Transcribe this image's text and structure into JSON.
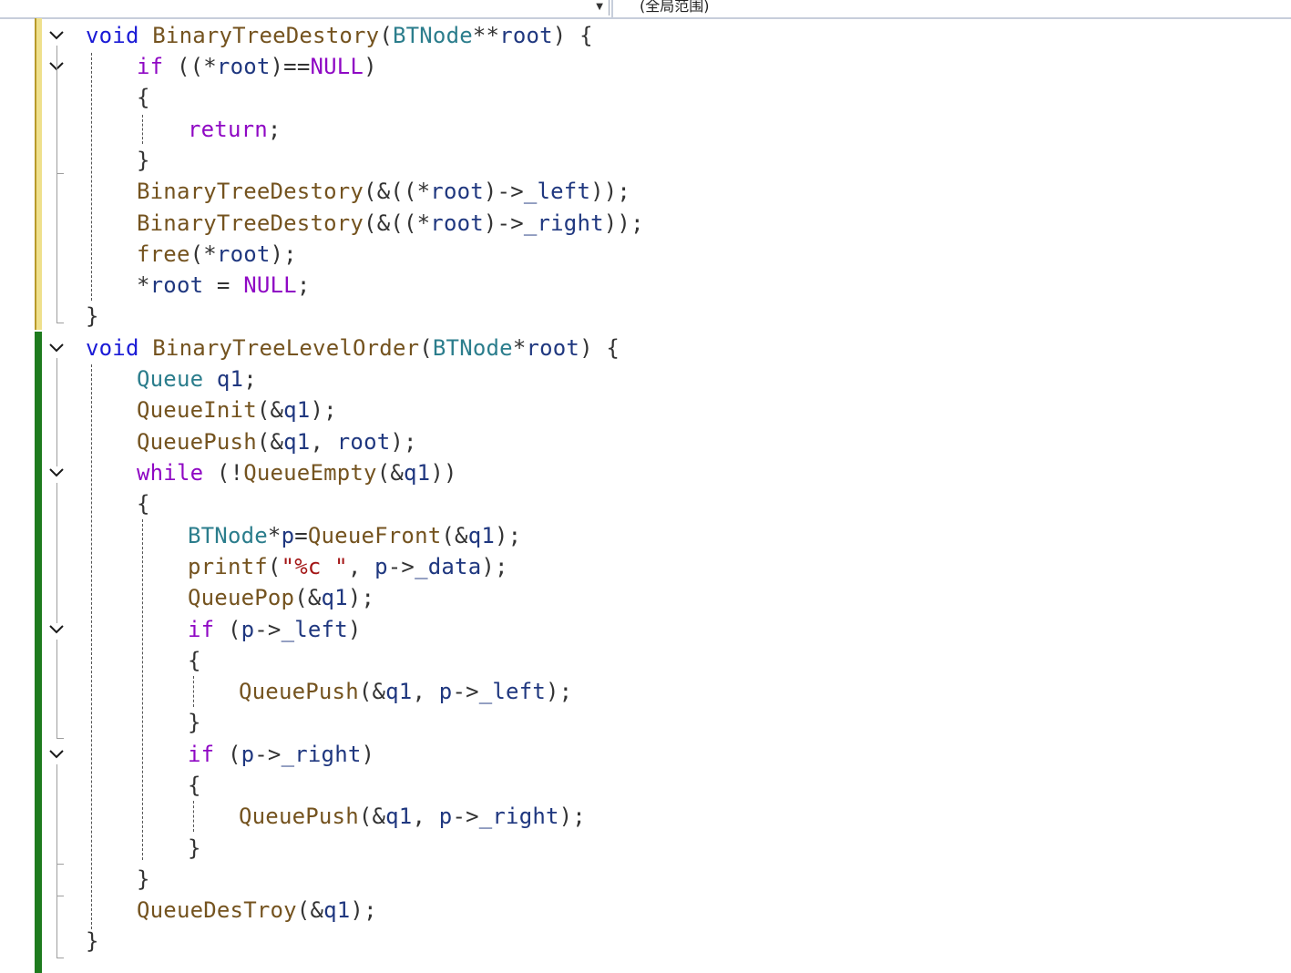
{
  "toolbar": {
    "scope_label": "(全局范围)"
  },
  "code": {
    "lines": [
      "void BinaryTreeDestory(BTNode**root) {",
      "if ((*root)==NULL)",
      "{",
      "return;",
      "}",
      "BinaryTreeDestory(&((*root)->_left));",
      "BinaryTreeDestory(&((*root)->_right));",
      "free(*root);",
      "*root = NULL;",
      "}",
      "void BinaryTreeLevelOrder(BTNode*root) {",
      "Queue q1;",
      "QueueInit(&q1);",
      "QueuePush(&q1, root);",
      "while (!QueueEmpty(&q1))",
      "{",
      "BTNode*p=QueueFront(&q1);",
      "printf(\"%c \", p->_data);",
      "QueuePop(&q1);",
      "if (p->_left)",
      "{",
      "QueuePush(&q1, p->_left);",
      "}",
      "if (p->_right)",
      "{",
      "QueuePush(&q1, p->_right);",
      "}",
      "}",
      "QueueDesTroy(&q1);",
      "}"
    ]
  },
  "colors": {
    "keyword": "#1a1ad6",
    "control": "#8f08c4",
    "type": "#2b7d8c",
    "function": "#74531f",
    "string": "#a31515",
    "changed_unsaved": "#efe08c",
    "changed_saved": "#1e7b1e"
  },
  "icons": {
    "fold_toggle": "chevron-down-icon"
  }
}
